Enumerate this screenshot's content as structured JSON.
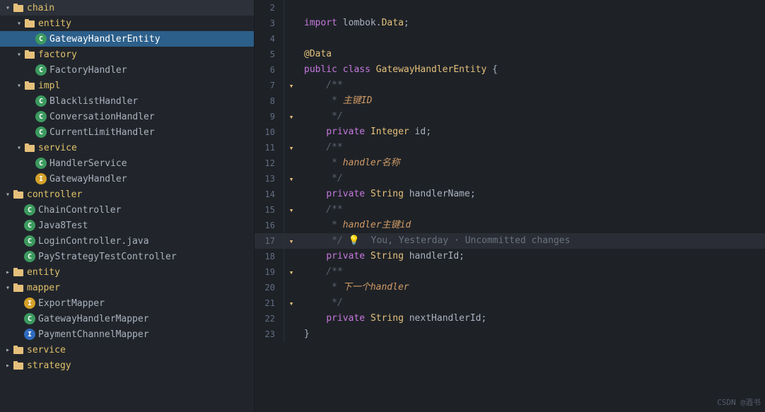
{
  "sidebar": {
    "items": [
      {
        "id": "chain-folder",
        "label": "chain",
        "type": "folder-open",
        "indent": 0
      },
      {
        "id": "entity-folder",
        "label": "entity",
        "type": "folder-open",
        "indent": 1
      },
      {
        "id": "GatewayHandlerEntity",
        "label": "GatewayHandlerEntity",
        "type": "file-c-green",
        "indent": 2,
        "selected": true
      },
      {
        "id": "factory-folder",
        "label": "factory",
        "type": "folder-open",
        "indent": 1
      },
      {
        "id": "FactoryHandler",
        "label": "FactoryHandler",
        "type": "file-c-green",
        "indent": 2
      },
      {
        "id": "impl-folder",
        "label": "impl",
        "type": "folder-open",
        "indent": 1
      },
      {
        "id": "BlacklistHandler",
        "label": "BlacklistHandler",
        "type": "file-c-green",
        "indent": 2
      },
      {
        "id": "ConversationHandler",
        "label": "ConversationHandler",
        "type": "file-c-green",
        "indent": 2
      },
      {
        "id": "CurrentLimitHandler",
        "label": "CurrentLimitHandler",
        "type": "file-c-green",
        "indent": 2
      },
      {
        "id": "service-folder",
        "label": "service",
        "type": "folder-open",
        "indent": 1
      },
      {
        "id": "HandlerService",
        "label": "HandlerService",
        "type": "file-c-green",
        "indent": 2
      },
      {
        "id": "GatewayHandler",
        "label": "GatewayHandler",
        "type": "file-c-orange",
        "indent": 2
      },
      {
        "id": "controller-folder",
        "label": "controller",
        "type": "folder-open",
        "indent": 0
      },
      {
        "id": "ChainController",
        "label": "ChainController",
        "type": "file-c-green",
        "indent": 1
      },
      {
        "id": "Java8Test",
        "label": "Java8Test",
        "type": "file-c-green",
        "indent": 1
      },
      {
        "id": "LoginController",
        "label": "LoginController.java",
        "type": "file-c-green",
        "indent": 1
      },
      {
        "id": "PayStrategyTestController",
        "label": "PayStrategyTestController",
        "type": "file-c-green",
        "indent": 1
      },
      {
        "id": "entity-folder2",
        "label": "entity",
        "type": "folder-closed",
        "indent": 0
      },
      {
        "id": "mapper-folder",
        "label": "mapper",
        "type": "folder-open",
        "indent": 0
      },
      {
        "id": "ExportMapper",
        "label": "ExportMapper",
        "type": "file-c-orange",
        "indent": 1
      },
      {
        "id": "GatewayHandlerMapper",
        "label": "GatewayHandlerMapper",
        "type": "file-c-green",
        "indent": 1
      },
      {
        "id": "PaymentChannelMapper",
        "label": "PaymentChannelMapper",
        "type": "file-c-blue",
        "indent": 1
      },
      {
        "id": "service-folder2",
        "label": "service",
        "type": "folder-closed",
        "indent": 0
      },
      {
        "id": "strategy-folder",
        "label": "strategy",
        "type": "folder-closed",
        "indent": 0
      }
    ]
  },
  "editor": {
    "lines": [
      {
        "num": 2,
        "content": ""
      },
      {
        "num": 3,
        "content": "import lombok.Data;"
      },
      {
        "num": 4,
        "content": ""
      },
      {
        "num": 5,
        "content": "@Data"
      },
      {
        "num": 6,
        "content": "public class GatewayHandlerEntity {"
      },
      {
        "num": 7,
        "content": "    /**",
        "gutter": "fold"
      },
      {
        "num": 8,
        "content": "     * 主键ID"
      },
      {
        "num": 9,
        "content": "     */",
        "gutter": "fold"
      },
      {
        "num": 10,
        "content": "    private Integer id;"
      },
      {
        "num": 11,
        "content": "    /**",
        "gutter": "fold"
      },
      {
        "num": 12,
        "content": "     * handler名称"
      },
      {
        "num": 13,
        "content": "     */",
        "gutter": "fold"
      },
      {
        "num": 14,
        "content": "    private String handlerName;"
      },
      {
        "num": 15,
        "content": "    /**",
        "gutter": "fold"
      },
      {
        "num": 16,
        "content": "     * handler主键id"
      },
      {
        "num": 17,
        "content": "     */",
        "gutter": "fold",
        "hint": "You, Yesterday · Uncommitted changes",
        "highlight": true
      },
      {
        "num": 18,
        "content": "    private String handlerId;"
      },
      {
        "num": 19,
        "content": "    /**",
        "gutter": "fold"
      },
      {
        "num": 20,
        "content": "     * 下一个handler"
      },
      {
        "num": 21,
        "content": "     */",
        "gutter": "fold"
      },
      {
        "num": 22,
        "content": "    private String nextHandlerId;"
      },
      {
        "num": 23,
        "content": "}"
      }
    ]
  },
  "watermark": {
    "text": "CSDN @酒书"
  }
}
